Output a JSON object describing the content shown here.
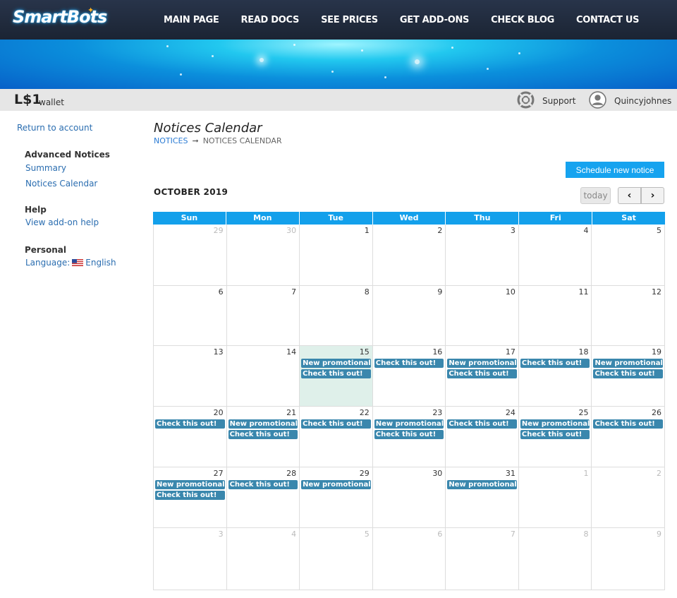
{
  "header": {
    "logo": "SmartBots",
    "nav": [
      "MAIN PAGE",
      "READ DOCS",
      "SEE PRICES",
      "GET ADD-ONS",
      "CHECK BLOG",
      "CONTACT US"
    ]
  },
  "wallet": {
    "amount": "L$1",
    "label": "wallet"
  },
  "userbar": {
    "support": "Support",
    "username": "Quincyjohnes"
  },
  "sidebar": {
    "return": "Return to account",
    "sections": [
      {
        "heading": "Advanced Notices",
        "items": [
          "Summary",
          "Notices Calendar"
        ]
      },
      {
        "heading": "Help",
        "items": [
          "View add-on help"
        ]
      },
      {
        "heading": "Personal",
        "items": []
      }
    ],
    "language_label": "Language:",
    "language_value": "English"
  },
  "main": {
    "title": "Notices Calendar",
    "breadcrumb": [
      "NOTICES",
      "NOTICES CALENDAR"
    ],
    "schedule_button": "Schedule new notice",
    "month": "OCTOBER 2019",
    "today_button": "today",
    "prev_icon": "chevron-left-icon",
    "next_icon": "chevron-right-icon"
  },
  "calendar": {
    "days": [
      "Sun",
      "Mon",
      "Tue",
      "Wed",
      "Thu",
      "Fri",
      "Sat"
    ],
    "weeks": [
      [
        {
          "d": "29",
          "o": true
        },
        {
          "d": "30",
          "o": true
        },
        {
          "d": "1"
        },
        {
          "d": "2"
        },
        {
          "d": "3"
        },
        {
          "d": "4"
        },
        {
          "d": "5"
        }
      ],
      [
        {
          "d": "6"
        },
        {
          "d": "7"
        },
        {
          "d": "8"
        },
        {
          "d": "9"
        },
        {
          "d": "10"
        },
        {
          "d": "11"
        },
        {
          "d": "12"
        }
      ],
      [
        {
          "d": "13"
        },
        {
          "d": "14"
        },
        {
          "d": "15",
          "today": true,
          "ev": [
            "New promotional offer",
            "Check this out!"
          ]
        },
        {
          "d": "16",
          "ev": [
            "Check this out!"
          ]
        },
        {
          "d": "17",
          "ev": [
            "New promotional offer",
            "Check this out!"
          ]
        },
        {
          "d": "18",
          "ev": [
            "Check this out!"
          ]
        },
        {
          "d": "19",
          "ev": [
            "New promotional offer",
            "Check this out!"
          ]
        }
      ],
      [
        {
          "d": "20",
          "ev": [
            "Check this out!"
          ]
        },
        {
          "d": "21",
          "ev": [
            "New promotional offer",
            "Check this out!"
          ]
        },
        {
          "d": "22",
          "ev": [
            "Check this out!"
          ]
        },
        {
          "d": "23",
          "ev": [
            "New promotional offer",
            "Check this out!"
          ]
        },
        {
          "d": "24",
          "ev": [
            "Check this out!"
          ]
        },
        {
          "d": "25",
          "ev": [
            "New promotional offer",
            "Check this out!"
          ]
        },
        {
          "d": "26",
          "ev": [
            "Check this out!"
          ]
        }
      ],
      [
        {
          "d": "27",
          "ev": [
            "New promotional offer",
            "Check this out!"
          ]
        },
        {
          "d": "28",
          "ev": [
            "Check this out!"
          ]
        },
        {
          "d": "29",
          "ev": [
            "New promotional offer"
          ]
        },
        {
          "d": "30"
        },
        {
          "d": "31",
          "ev": [
            "New promotional offer"
          ]
        },
        {
          "d": "1",
          "o": true
        },
        {
          "d": "2",
          "o": true
        }
      ],
      [
        {
          "d": "3",
          "o": true
        },
        {
          "d": "4",
          "o": true
        },
        {
          "d": "5",
          "o": true
        },
        {
          "d": "6",
          "o": true
        },
        {
          "d": "7",
          "o": true
        },
        {
          "d": "8",
          "o": true
        },
        {
          "d": "9",
          "o": true
        }
      ]
    ]
  },
  "colors": {
    "accent": "#16a3ef",
    "event": "#3a87ad",
    "today": "#dff0ea",
    "header": "#1f2a3a"
  }
}
